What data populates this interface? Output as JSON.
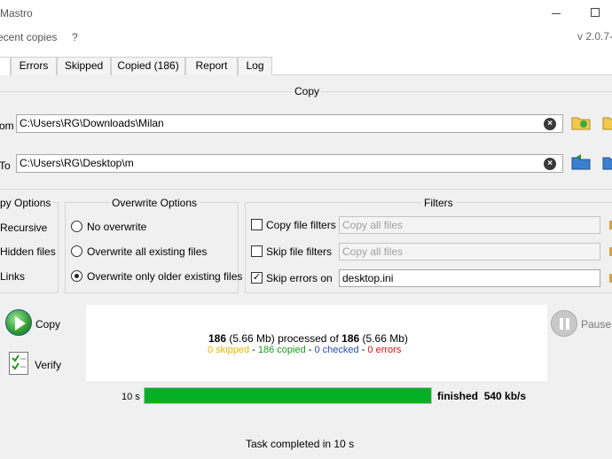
{
  "window": {
    "title": "yMastro",
    "version": "v 2.0.7-"
  },
  "menu": [
    "ecent copies",
    "?"
  ],
  "tabs": [
    "Errors",
    "Skipped",
    "Copied (186)",
    "Report",
    "Log"
  ],
  "copy_group": {
    "title": "Copy",
    "from_label": "om",
    "from_path": "C:\\Users\\RG\\Downloads\\Milan",
    "to_label": "To",
    "to_path": "C:\\Users\\RG\\Desktop\\m"
  },
  "copy_options": {
    "title": "py Options",
    "items": [
      "Recursive",
      "Hidden files",
      "Links"
    ]
  },
  "overwrite_options": {
    "title": "Overwrite Options",
    "items": [
      "No overwrite",
      "Overwrite all existing files",
      "Overwrite only older existing files"
    ],
    "selected": "Overwrite only older existing files"
  },
  "filters": {
    "title": "Filters",
    "copy_filter": {
      "label": "Copy file filters",
      "checked": false,
      "value": "Copy all files"
    },
    "skip_filter": {
      "label": "Skip file filters",
      "checked": false,
      "value": "Copy all files"
    },
    "skip_errors": {
      "label": "Skip errors on",
      "checked": true,
      "value": "desktop.ini"
    }
  },
  "actions": {
    "copy": "Copy",
    "verify": "Verify",
    "pause": "Pause"
  },
  "stats": {
    "processed_count": "186",
    "processed_size": "(5.66 Mb)",
    "processed_of": "processed of",
    "total_count": "186",
    "total_size": "(5.66 Mb)",
    "skipped": "0 skipped",
    "copied": "186 copied",
    "checked": "0 checked",
    "errors": "0 errors",
    "sep": " - "
  },
  "progress": {
    "elapsed": "10 s",
    "fraction": 1.0,
    "finished": "finished",
    "speed": "540 kb/s"
  },
  "status": "Task completed in 10 s",
  "colors": {
    "skipped": "#e8b400",
    "copied": "#1a9a1a",
    "checked": "#1f4fb4",
    "errors": "#e01010",
    "progress": "#06b025"
  }
}
